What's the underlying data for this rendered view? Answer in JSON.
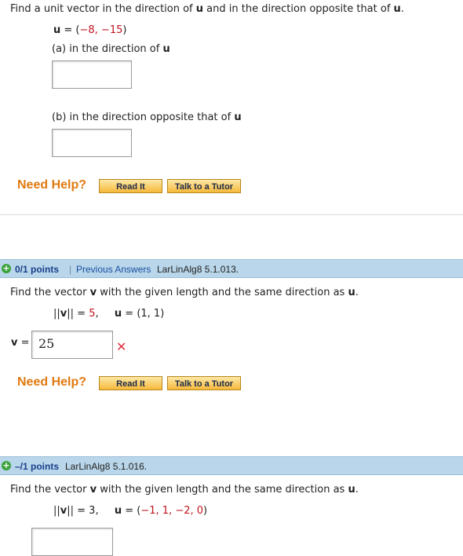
{
  "q1": {
    "prompt_pre": "Find a unit vector in the direction of ",
    "prompt_var": "u",
    "prompt_mid": " and in the direction opposite that of ",
    "prompt_var2": "u",
    "prompt_end": ".",
    "given_var": "u",
    "given_eq": " = (",
    "given_vals": "−8, −15",
    "given_close": ")",
    "part_a_label": "(a) in the direction of ",
    "part_a_var": "u",
    "part_a_value": "",
    "part_b_label": "(b) in the direction opposite that of ",
    "part_b_var": "u",
    "part_b_value": "",
    "need_help": "Need Help?",
    "read_it": "Read It",
    "talk_tutor": "Talk to a Tutor"
  },
  "q2": {
    "icon": "plus-icon",
    "points": "0/1 points",
    "separator": "|",
    "previous_answers": "Previous Answers",
    "ref": "LarLinAlg8 5.1.013.",
    "prompt_pre": "Find the vector ",
    "prompt_var": "v",
    "prompt_mid": " with the given length and the same direction as ",
    "prompt_var2": "u",
    "prompt_end": ".",
    "norm_open": "||",
    "norm_var": "v",
    "norm_close": "||",
    "norm_eq": " = ",
    "norm_val": "5",
    "comma": ",",
    "u_var": "u",
    "u_eq": " = (1, 1)",
    "answer_label_var": "v",
    "answer_label_eq": " =",
    "answer_value": "25",
    "status_icon": "x-mark-icon",
    "status_glyph": "✕",
    "need_help": "Need Help?",
    "read_it": "Read It",
    "talk_tutor": "Talk to a Tutor"
  },
  "q3": {
    "icon": "plus-icon",
    "points": "–/1 points",
    "ref": "LarLinAlg8 5.1.016.",
    "prompt_pre": "Find the vector ",
    "prompt_var": "v",
    "prompt_mid": " with the given length and the same direction as ",
    "prompt_var2": "u",
    "prompt_end": ".",
    "norm_open": "||",
    "norm_var": "v",
    "norm_close": "||",
    "norm_eq": " = 3,",
    "u_var": "u",
    "u_eq": " = (",
    "u_vals": "−1, 1, −2, 0",
    "u_close": ")"
  },
  "colors": {
    "accent_orange": "#e07a10",
    "bar_blue": "#b9d6ea",
    "link_blue": "#1a4fa0",
    "error_red": "#e0303c",
    "value_red": "#c0141e"
  }
}
